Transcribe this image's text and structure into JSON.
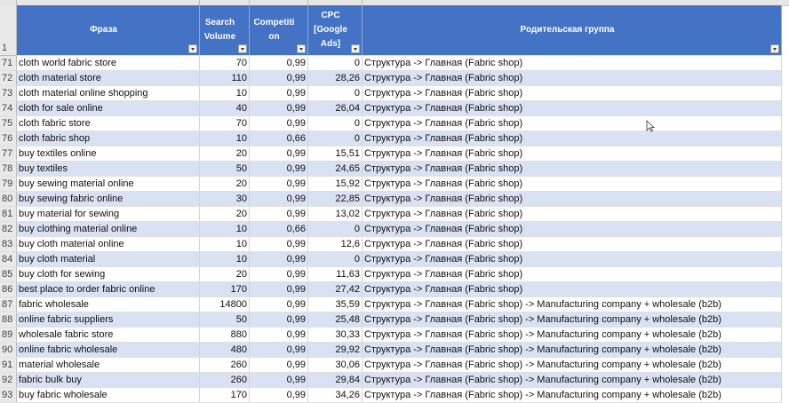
{
  "headers": {
    "row_number": "1",
    "phrase": "Фраза",
    "volume": "Search Volume",
    "competition": "Competition",
    "cpc": "CPC [Google Ads]",
    "group": "Родительская группа"
  },
  "rows": [
    {
      "n": "71",
      "phrase": "cloth world fabric store",
      "volume": "70",
      "competition": "0,99",
      "cpc": "0",
      "group": "Структура -> Главная (Fabric shop)"
    },
    {
      "n": "72",
      "phrase": "cloth material store",
      "volume": "110",
      "competition": "0,99",
      "cpc": "28,26",
      "group": "Структура -> Главная (Fabric shop)"
    },
    {
      "n": "73",
      "phrase": "cloth material online shopping",
      "volume": "10",
      "competition": "0,99",
      "cpc": "0",
      "group": "Структура -> Главная (Fabric shop)"
    },
    {
      "n": "74",
      "phrase": "cloth for sale online",
      "volume": "40",
      "competition": "0,99",
      "cpc": "26,04",
      "group": "Структура -> Главная (Fabric shop)"
    },
    {
      "n": "75",
      "phrase": "cloth fabric store",
      "volume": "70",
      "competition": "0,99",
      "cpc": "0",
      "group": "Структура -> Главная (Fabric shop)"
    },
    {
      "n": "76",
      "phrase": "cloth fabric shop",
      "volume": "10",
      "competition": "0,66",
      "cpc": "0",
      "group": "Структура -> Главная (Fabric shop)"
    },
    {
      "n": "77",
      "phrase": "buy textiles online",
      "volume": "20",
      "competition": "0,99",
      "cpc": "15,51",
      "group": "Структура -> Главная (Fabric shop)"
    },
    {
      "n": "78",
      "phrase": "buy textiles",
      "volume": "50",
      "competition": "0,99",
      "cpc": "24,65",
      "group": "Структура -> Главная (Fabric shop)"
    },
    {
      "n": "79",
      "phrase": "buy sewing material online",
      "volume": "20",
      "competition": "0,99",
      "cpc": "15,92",
      "group": "Структура -> Главная (Fabric shop)"
    },
    {
      "n": "80",
      "phrase": "buy sewing fabric online",
      "volume": "30",
      "competition": "0,99",
      "cpc": "22,85",
      "group": "Структура -> Главная (Fabric shop)"
    },
    {
      "n": "81",
      "phrase": "buy material for sewing",
      "volume": "20",
      "competition": "0,99",
      "cpc": "13,02",
      "group": "Структура -> Главная (Fabric shop)"
    },
    {
      "n": "82",
      "phrase": "buy clothing material online",
      "volume": "10",
      "competition": "0,66",
      "cpc": "0",
      "group": "Структура -> Главная (Fabric shop)"
    },
    {
      "n": "83",
      "phrase": "buy cloth material online",
      "volume": "10",
      "competition": "0,99",
      "cpc": "12,6",
      "group": "Структура -> Главная (Fabric shop)"
    },
    {
      "n": "84",
      "phrase": "buy cloth material",
      "volume": "10",
      "competition": "0,99",
      "cpc": "0",
      "group": "Структура -> Главная (Fabric shop)"
    },
    {
      "n": "85",
      "phrase": "buy cloth for sewing",
      "volume": "20",
      "competition": "0,99",
      "cpc": "11,63",
      "group": "Структура -> Главная (Fabric shop)"
    },
    {
      "n": "86",
      "phrase": "best place to order fabric online",
      "volume": "170",
      "competition": "0,99",
      "cpc": "27,42",
      "group": "Структура -> Главная (Fabric shop)"
    },
    {
      "n": "87",
      "phrase": "fabric wholesale",
      "volume": "14800",
      "competition": "0,99",
      "cpc": "35,59",
      "group": "Структура -> Главная (Fabric shop) -> Manufacturing company + wholesale (b2b)"
    },
    {
      "n": "88",
      "phrase": "online fabric suppliers",
      "volume": "50",
      "competition": "0,99",
      "cpc": "25,48",
      "group": "Структура -> Главная (Fabric shop) -> Manufacturing company + wholesale (b2b)"
    },
    {
      "n": "89",
      "phrase": "wholesale fabric store",
      "volume": "880",
      "competition": "0,99",
      "cpc": "30,33",
      "group": "Структура -> Главная (Fabric shop) -> Manufacturing company + wholesale (b2b)"
    },
    {
      "n": "90",
      "phrase": "online fabric wholesale",
      "volume": "480",
      "competition": "0,99",
      "cpc": "29,92",
      "group": "Структура -> Главная (Fabric shop) -> Manufacturing company + wholesale (b2b)"
    },
    {
      "n": "91",
      "phrase": "material wholesale",
      "volume": "260",
      "competition": "0,99",
      "cpc": "30,06",
      "group": "Структура -> Главная (Fabric shop) -> Manufacturing company + wholesale (b2b)"
    },
    {
      "n": "92",
      "phrase": "fabric bulk buy",
      "volume": "260",
      "competition": "0,99",
      "cpc": "29,84",
      "group": "Структура -> Главная (Fabric shop) -> Manufacturing company + wholesale (b2b)"
    },
    {
      "n": "93",
      "phrase": "buy fabric wholesale",
      "volume": "170",
      "competition": "0,99",
      "cpc": "34,26",
      "group": "Структура -> Главная (Fabric shop) -> Manufacturing company + wholesale (b2b)"
    }
  ]
}
